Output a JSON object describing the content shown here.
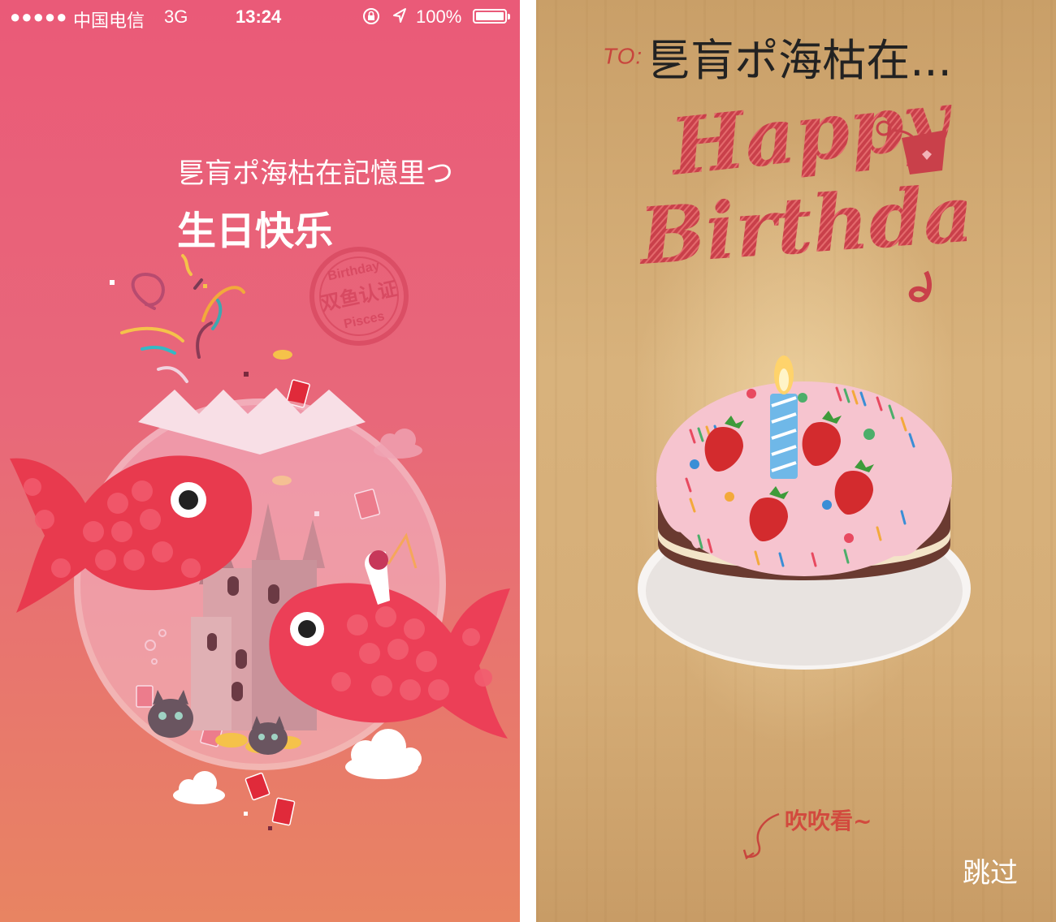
{
  "status_bar": {
    "signal": "●●●●●",
    "carrier": "中国电信",
    "network": "3G",
    "time": "13:24",
    "battery_percent": "100%",
    "battery_level": 1.0
  },
  "left_screen": {
    "greeting": "乬肓ポ海枯在記憶里つ",
    "title": "生日快乐",
    "stamp_top": "Birthday",
    "stamp_middle": "双鱼认证",
    "stamp_bottom": "Pisces",
    "colors": {
      "background_top": "#ea5a78",
      "background_bottom": "#e88462",
      "fish": "#e83a4e"
    }
  },
  "right_screen": {
    "to_label": "TO:",
    "to_name": "乬肓ポ海枯在...",
    "happy_text": "Happy",
    "birthday_text": "Birthday",
    "blow_hint": "吹吹看~",
    "skip_label": "跳过",
    "colors": {
      "wood": "#d6ae78",
      "accent_red": "#c8453d",
      "cake_icing": "#f6c4cf"
    }
  },
  "icons": [
    "orientation-lock-icon",
    "location-arrow-icon",
    "battery-icon",
    "curved-arrow-icon",
    "candle-icon",
    "strawberry-icon",
    "fish-icon",
    "castle-icon",
    "cloud-icon"
  ]
}
